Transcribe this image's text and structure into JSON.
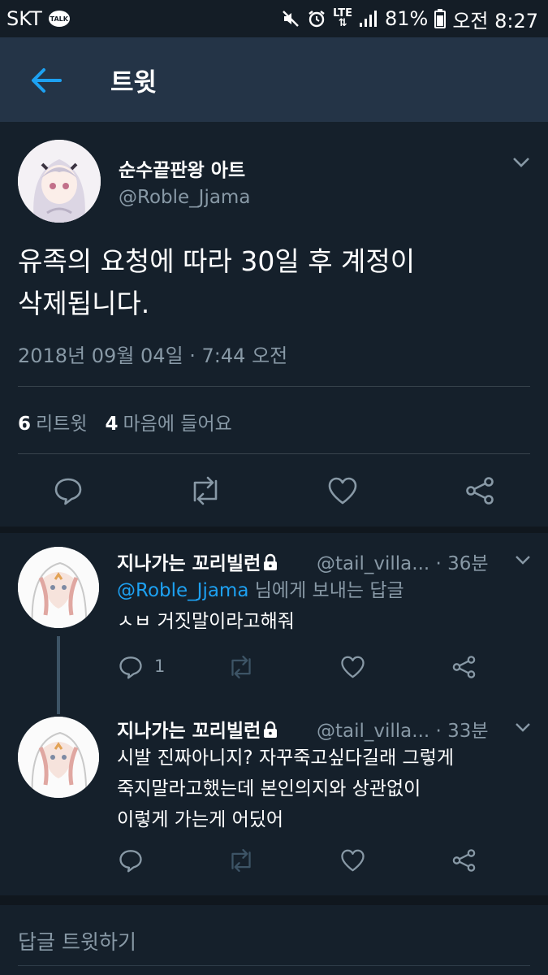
{
  "status_bar": {
    "carrier": "SKT",
    "talk_badge": "TALK",
    "network": "LTE",
    "battery": "81%",
    "time": "오전 8:27"
  },
  "header": {
    "title": "트윗"
  },
  "main_tweet": {
    "display_name": "순수끝판왕 아트",
    "handle": "@Roble_Jjama",
    "text_line1": "유족의 요청에 따라 30일 후 계정이",
    "text_line2": "삭제됩니다.",
    "timestamp": "2018년 09월 04일 · 7:44 오전",
    "retweet_count": "6",
    "retweet_label": "리트윗",
    "like_count": "4",
    "like_label": "마음에 들어요"
  },
  "replies": [
    {
      "display_name": "지나가는 꼬리빌런",
      "handle": "@tail_villa...",
      "time": "· 36분",
      "replying_mention": "@Roble_Jjama",
      "replying_suffix": " 님에게 보내는 답글",
      "text": "ㅅㅂ 거짓말이라고해줘",
      "reply_count": "1"
    },
    {
      "display_name": "지나가는 꼬리빌런",
      "handle": "@tail_villa...",
      "time": "· 33분",
      "text_line1": "시발 진짜아니지? 자꾸죽고싶다길래 그렇게",
      "text_line2": "죽지말라고했는데 본인의지와 상관없이",
      "text_line3": "이렇게 가는게 어딨어"
    }
  ],
  "compose": {
    "placeholder": "답글 트윗하기"
  },
  "colors": {
    "background": "#15202b",
    "header": "#243447",
    "accent": "#1da1f2",
    "secondary_text": "#8899a6"
  }
}
